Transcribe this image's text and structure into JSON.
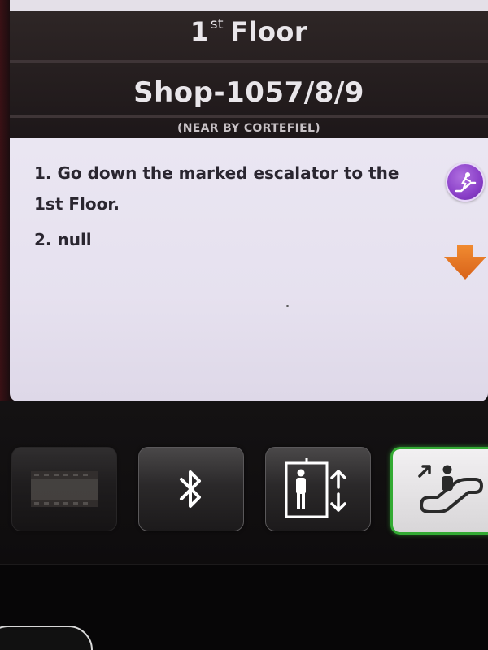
{
  "header": {
    "floor_number": "1",
    "floor_ordinal": "st",
    "floor_word": "Floor",
    "shop": "Shop-1057/8/9",
    "near": "(NEAR BY CORTEFIEL)"
  },
  "instructions": {
    "steps": [
      "1. Go down the marked escalator to the 1st Floor.",
      "2. null"
    ]
  },
  "icons": {
    "escalator_badge": "escalator-person-icon",
    "direction": "down-arrow-icon"
  },
  "modes": {
    "items": [
      {
        "name": "video",
        "icon": "film-icon",
        "selected": false
      },
      {
        "name": "bluetooth",
        "icon": "bluetooth-icon",
        "selected": false
      },
      {
        "name": "elevator",
        "icon": "elevator-icon",
        "selected": false
      },
      {
        "name": "escalator",
        "icon": "escalator-icon",
        "selected": true
      }
    ]
  },
  "colors": {
    "accent_purple": "#8a3fc8",
    "arrow_orange": "#e8751e",
    "selected_green": "#33aa33"
  }
}
